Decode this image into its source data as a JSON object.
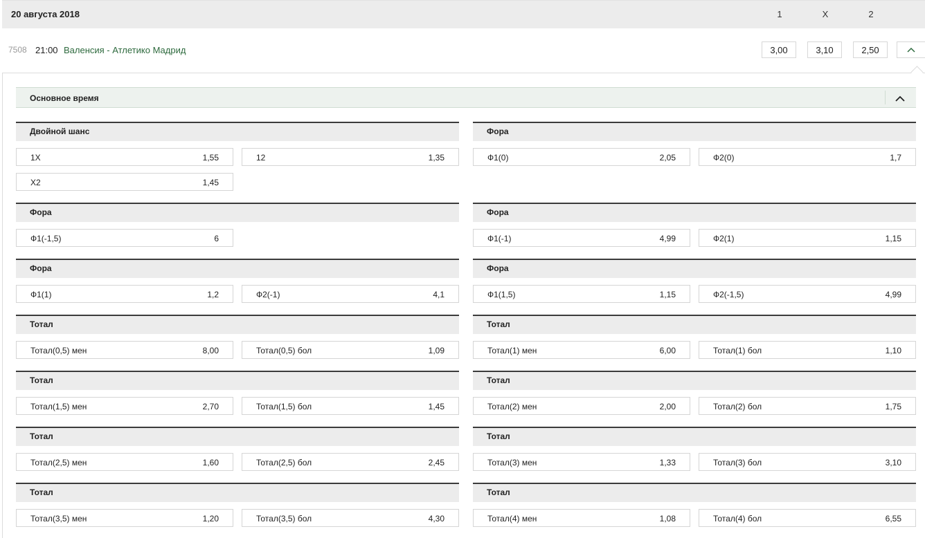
{
  "header": {
    "date": "20 августа 2018",
    "col1": "1",
    "colx": "X",
    "col2": "2"
  },
  "event": {
    "number": "7508",
    "time": "21:00",
    "teams": "Валенсия - Атлетико Мадрид",
    "odds": [
      "3,00",
      "3,10",
      "2,50"
    ]
  },
  "section": {
    "title": "Основное время"
  },
  "groups": [
    {
      "title": "Двойной шанс",
      "bets": [
        {
          "label": "1X",
          "value": "1,55"
        },
        {
          "label": "12",
          "value": "1,35"
        },
        {
          "label": "X2",
          "value": "1,45"
        }
      ]
    },
    {
      "title": "Фора",
      "bets": [
        {
          "label": "Ф1(0)",
          "value": "2,05"
        },
        {
          "label": "Ф2(0)",
          "value": "1,7"
        }
      ]
    },
    {
      "title": "Фора",
      "bets": [
        {
          "label": "Ф1(-1,5)",
          "value": "6"
        }
      ]
    },
    {
      "title": "Фора",
      "bets": [
        {
          "label": "Ф1(-1)",
          "value": "4,99"
        },
        {
          "label": "Ф2(1)",
          "value": "1,15"
        }
      ]
    },
    {
      "title": "Фора",
      "bets": [
        {
          "label": "Ф1(1)",
          "value": "1,2"
        },
        {
          "label": "Ф2(-1)",
          "value": "4,1"
        }
      ]
    },
    {
      "title": "Фора",
      "bets": [
        {
          "label": "Ф1(1,5)",
          "value": "1,15"
        },
        {
          "label": "Ф2(-1,5)",
          "value": "4,99"
        }
      ]
    },
    {
      "title": "Тотал",
      "bets": [
        {
          "label": "Тотал(0,5) мен",
          "value": "8,00"
        },
        {
          "label": "Тотал(0,5) бол",
          "value": "1,09"
        }
      ]
    },
    {
      "title": "Тотал",
      "bets": [
        {
          "label": "Тотал(1) мен",
          "value": "6,00"
        },
        {
          "label": "Тотал(1) бол",
          "value": "1,10"
        }
      ]
    },
    {
      "title": "Тотал",
      "bets": [
        {
          "label": "Тотал(1,5) мен",
          "value": "2,70"
        },
        {
          "label": "Тотал(1,5) бол",
          "value": "1,45"
        }
      ]
    },
    {
      "title": "Тотал",
      "bets": [
        {
          "label": "Тотал(2) мен",
          "value": "2,00"
        },
        {
          "label": "Тотал(2) бол",
          "value": "1,75"
        }
      ]
    },
    {
      "title": "Тотал",
      "bets": [
        {
          "label": "Тотал(2,5) мен",
          "value": "1,60"
        },
        {
          "label": "Тотал(2,5) бол",
          "value": "2,45"
        }
      ]
    },
    {
      "title": "Тотал",
      "bets": [
        {
          "label": "Тотал(3) мен",
          "value": "1,33"
        },
        {
          "label": "Тотал(3) бол",
          "value": "3,10"
        }
      ]
    },
    {
      "title": "Тотал",
      "bets": [
        {
          "label": "Тотал(3,5) мен",
          "value": "1,20"
        },
        {
          "label": "Тотал(3,5) бол",
          "value": "4,30"
        }
      ]
    },
    {
      "title": "Тотал",
      "bets": [
        {
          "label": "Тотал(4) мен",
          "value": "1,08"
        },
        {
          "label": "Тотал(4) бол",
          "value": "6,55"
        }
      ]
    }
  ],
  "colors": {
    "accent_green": "#2e6a3e",
    "section_bg": "#edf2ee",
    "group_bg": "#ececec"
  },
  "icons": {
    "expand": "chevron-up-icon",
    "collapse": "chevron-up-icon"
  }
}
